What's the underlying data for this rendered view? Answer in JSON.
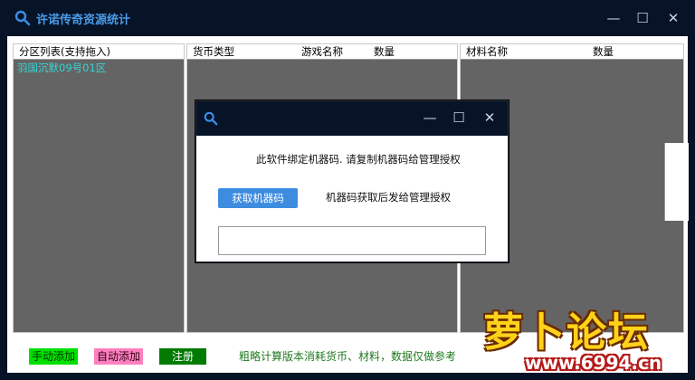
{
  "window": {
    "title": "许诺传奇资源统计",
    "minimize": "—",
    "maximize": "☐",
    "close": "✕"
  },
  "panels": {
    "left": {
      "header": "分区列表(支持拖入)",
      "items": [
        "羽国沉默09号01区"
      ]
    },
    "middle": {
      "headers": [
        "货币类型",
        "游戏名称",
        "数量"
      ]
    },
    "right": {
      "headers": [
        "材料名称",
        "数量"
      ]
    }
  },
  "bottom": {
    "manual_add": "手动添加",
    "auto_add": "自动添加",
    "register": "注册",
    "note": "粗略计算版本消耗货币、材料，数据仅做参考"
  },
  "dialog": {
    "message": "此软件绑定机器码. 请复制机器码给管理授权",
    "get_code_button": "获取机器码",
    "hint": "机器码获取后发给管理授权",
    "code_value": "",
    "minimize": "—",
    "maximize": "☐",
    "close": "✕"
  },
  "watermark": {
    "logo_text": "萝卜论坛",
    "url": "www.6994.cn"
  },
  "colors": {
    "title_bg": "#071327",
    "accent": "#3d8ce0",
    "panel_bg": "#646464",
    "green_btn": "#00c800",
    "pink_btn": "#ff80c0",
    "dark_green_btn": "#007a00"
  }
}
